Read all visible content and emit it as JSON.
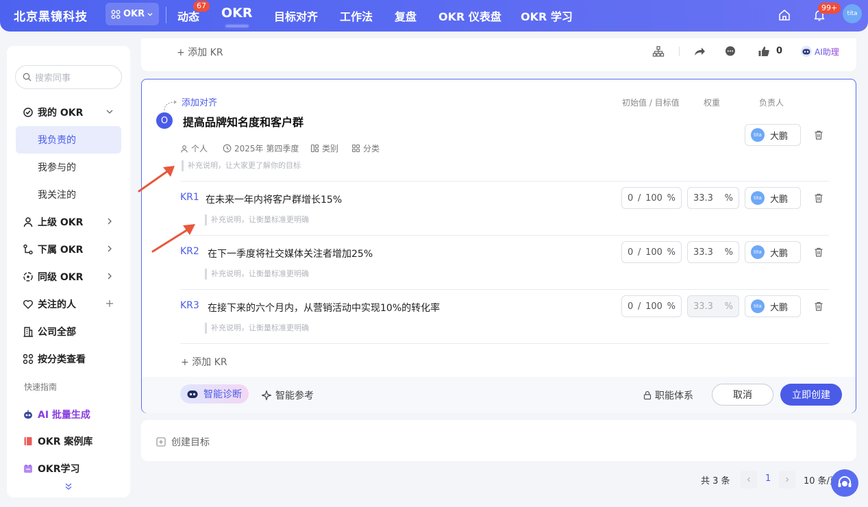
{
  "topbar": {
    "brand": "北京黑镜科技",
    "okr_switch": "OKR",
    "nav": [
      "动态",
      "OKR",
      "目标对齐",
      "工作法",
      "复盘",
      "OKR 仪表盘",
      "OKR 学习"
    ],
    "dynamic_badge": "67",
    "notice_badge": "99+",
    "avatar_text": "tita"
  },
  "sidebar": {
    "search_placeholder": "搜索同事",
    "my_okr": "我的 OKR",
    "my_sub": [
      "我负责的",
      "我参与的",
      "我关注的"
    ],
    "items": [
      "上级 OKR",
      "下属 OKR",
      "同级 OKR",
      "关注的人",
      "公司全部",
      "按分类查看"
    ],
    "guide_title": "快速指南",
    "guides": [
      "AI 批量生成",
      "OKR 案例库",
      "OKR学习"
    ]
  },
  "prev_card": {
    "add_kr": "添加 KR",
    "like_count": "0",
    "ai_assistant": "AI助理"
  },
  "objective": {
    "add_align": "添加对齐",
    "col_value": "初始值 / 目标值",
    "col_weight": "权重",
    "col_owner": "负责人",
    "circle": "O",
    "title": "提高品牌知名度和客户群",
    "meta_owner_type": "个人",
    "meta_period": "2025年 第四季度",
    "meta_type": "类别",
    "meta_category": "分类",
    "desc_placeholder": "补充说明，让大家更了解你的目标",
    "owner": "大鹏"
  },
  "krs": [
    {
      "label": "KR1",
      "text": "在未来一年内将客户群增长15%",
      "start": "0",
      "sep": "/",
      "target": "100",
      "pct": "%",
      "weight": "33.3",
      "owner": "大鹏",
      "desc": "补充说明，让衡量标准更明确"
    },
    {
      "label": "KR2",
      "text": "在下一季度将社交媒体关注者增加25%",
      "start": "0",
      "sep": "/",
      "target": "100",
      "pct": "%",
      "weight": "33.3",
      "owner": "大鹏",
      "desc": "补充说明，让衡量标准更明确"
    },
    {
      "label": "KR3",
      "text": "在接下来的六个月内，从营销活动中实现10%的转化率",
      "start": "0",
      "sep": "/",
      "target": "100",
      "pct": "%",
      "weight": "33.3",
      "owner": "大鹏",
      "desc": "补充说明，让衡量标准更明确"
    }
  ],
  "add_kr": "添加 KR",
  "footer": {
    "diagnose": "智能诊断",
    "reference": "智能参考",
    "function_system": "职能体系",
    "cancel": "取消",
    "create": "立即创建"
  },
  "create_goal": "创建目标",
  "pagination": {
    "total": "共 3 条",
    "page": "1",
    "per_page": "10 条/页"
  },
  "colors": {
    "primary": "#4a5be8",
    "badge": "#f04e3a",
    "annotation_arrow": "#e8573b"
  }
}
